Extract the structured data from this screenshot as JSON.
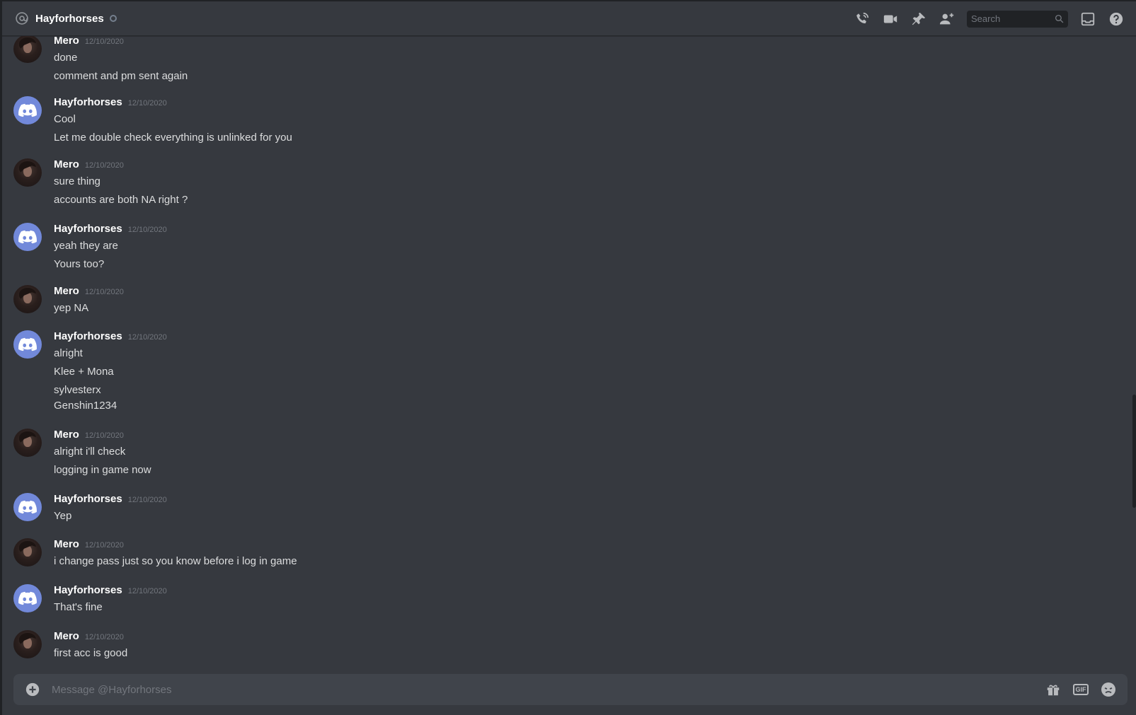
{
  "header": {
    "title": "Hayforhorses",
    "search_placeholder": "Search"
  },
  "icons": {
    "at": "at-sign-icon",
    "call": "phone-call-icon",
    "video": "video-camera-icon",
    "pin": "pin-icon",
    "add_friend": "add-friend-icon",
    "search": "search-icon",
    "inbox": "inbox-icon",
    "help": "help-icon",
    "attach": "plus-circle-icon",
    "gift": "gift-icon",
    "gif": "gif-icon",
    "emoji": "emoji-icon"
  },
  "colors": {
    "background": "#36393f",
    "discord_blurple": "#7289da",
    "username": "#ffffff",
    "text": "#dcddde",
    "muted": "#72767d"
  },
  "messages": [
    {
      "author": "Mero",
      "avatar": "photo",
      "timestamp": "12/10/2020",
      "lines": [
        "done",
        "comment and pm sent again"
      ]
    },
    {
      "author": "Hayforhorses",
      "avatar": "discord",
      "timestamp": "12/10/2020",
      "lines": [
        "Cool",
        "Let me double check everything is unlinked for you"
      ]
    },
    {
      "author": "Mero",
      "avatar": "photo",
      "timestamp": "12/10/2020",
      "lines": [
        "sure thing",
        "accounts are both NA right ?"
      ]
    },
    {
      "author": "Hayforhorses",
      "avatar": "discord",
      "timestamp": "12/10/2020",
      "lines": [
        "yeah they are",
        "Yours too?"
      ]
    },
    {
      "author": "Mero",
      "avatar": "photo",
      "timestamp": "12/10/2020",
      "lines": [
        "yep NA"
      ]
    },
    {
      "author": "Hayforhorses",
      "avatar": "discord",
      "timestamp": "12/10/2020",
      "lines": [
        "alright",
        "Klee + Mona",
        "sylvesterx",
        "Genshin1234"
      ]
    },
    {
      "author": "Mero",
      "avatar": "photo",
      "timestamp": "12/10/2020",
      "lines": [
        "alright i'll check",
        "logging in game now"
      ]
    },
    {
      "author": "Hayforhorses",
      "avatar": "discord",
      "timestamp": "12/10/2020",
      "lines": [
        "Yep"
      ]
    },
    {
      "author": "Mero",
      "avatar": "photo",
      "timestamp": "12/10/2020",
      "lines": [
        "i change pass just so you know before i log in game"
      ]
    },
    {
      "author": "Hayforhorses",
      "avatar": "discord",
      "timestamp": "12/10/2020",
      "lines": [
        "That's fine"
      ]
    },
    {
      "author": "Mero",
      "avatar": "photo",
      "timestamp": "12/10/2020",
      "lines": [
        "first acc is good"
      ]
    }
  ],
  "composer": {
    "placeholder": "Message @Hayforhorses",
    "gif_label": "GIF"
  }
}
